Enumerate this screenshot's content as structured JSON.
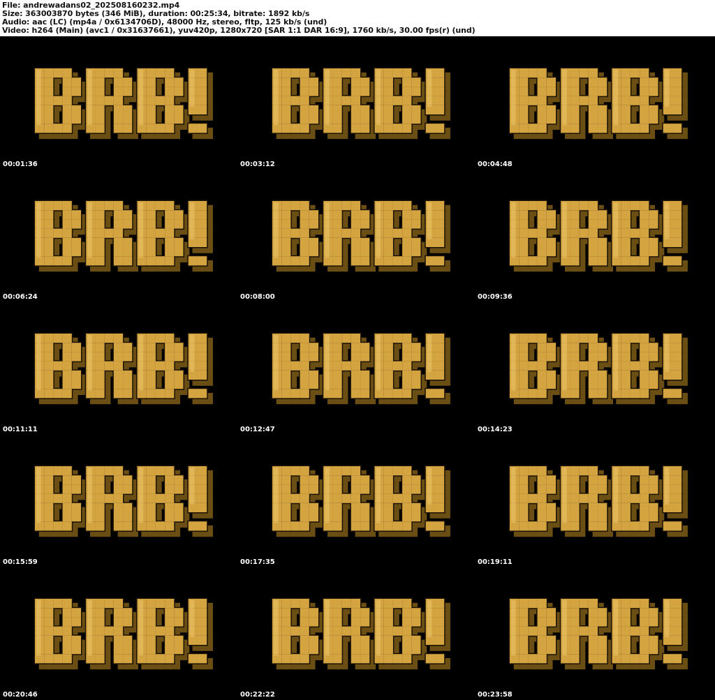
{
  "header": {
    "file_line": "File: andrewadans02_202508160232.mp4",
    "size_line": "Size: 363003870 bytes (346 MiB), duration: 00:25:34, bitrate: 1892 kb/s",
    "audio_line": "Audio: aac (LC) (mp4a / 0x6134706D), 48000 Hz, stereo, fltp, 125 kb/s (und)",
    "video_line": "Video: h264 (Main) (avc1 / 0x31637661), yuv420p, 1280x720 [SAR 1:1 DAR 16:9], 1760 kb/s, 30.00 fps(r) (und)"
  },
  "thumbnails": [
    {
      "timestamp": "00:01:36",
      "image_text": "BRB!"
    },
    {
      "timestamp": "00:03:12",
      "image_text": "BRB!"
    },
    {
      "timestamp": "00:04:48",
      "image_text": "BRB!"
    },
    {
      "timestamp": "00:06:24",
      "image_text": "BRB!"
    },
    {
      "timestamp": "00:08:00",
      "image_text": "BRB!"
    },
    {
      "timestamp": "00:09:36",
      "image_text": "BRB!"
    },
    {
      "timestamp": "00:11:11",
      "image_text": "BRB!"
    },
    {
      "timestamp": "00:12:47",
      "image_text": "BRB!"
    },
    {
      "timestamp": "00:14:23",
      "image_text": "BRB!"
    },
    {
      "timestamp": "00:15:59",
      "image_text": "BRB!"
    },
    {
      "timestamp": "00:17:35",
      "image_text": "BRB!"
    },
    {
      "timestamp": "00:19:11",
      "image_text": "BRB!"
    },
    {
      "timestamp": "00:20:46",
      "image_text": "BRB!"
    },
    {
      "timestamp": "00:22:22",
      "image_text": "BRB!"
    },
    {
      "timestamp": "00:23:58",
      "image_text": "BRB!"
    }
  ],
  "colors": {
    "background": "#000000",
    "header_background": "#ffffff",
    "header_text": "#111111",
    "timestamp_text": "#ffffff",
    "logo_fill": "#d4a441",
    "logo_highlight": "#e9c46a",
    "logo_shadow": "#6b4e14",
    "logo_outline": "#1a1206"
  }
}
